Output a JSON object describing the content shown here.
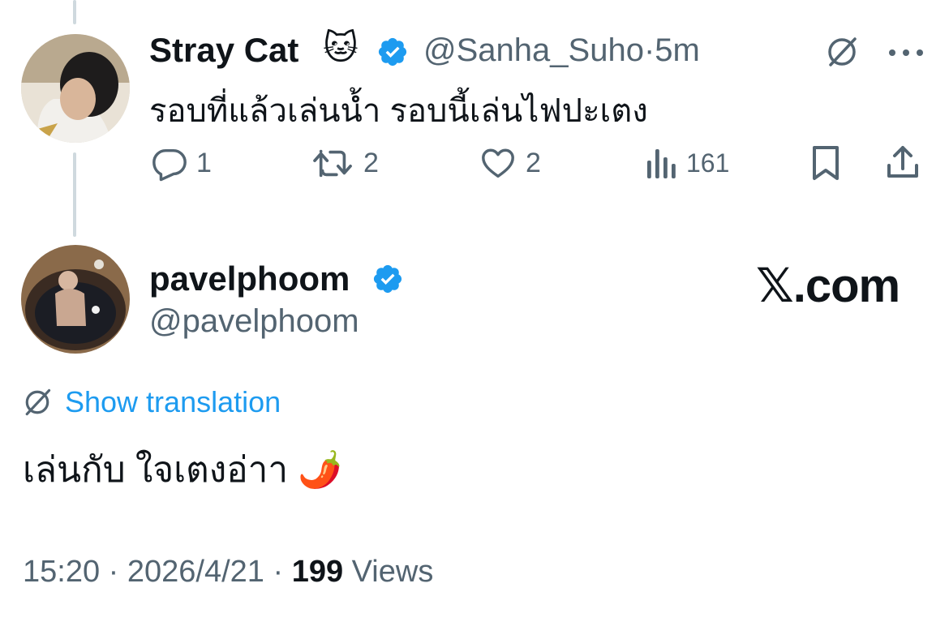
{
  "reply_tweet": {
    "display_name": "Stray Cat",
    "name_emoji": "🐱",
    "handle": "@Sanha_Suho",
    "separator": "·",
    "time_ago": "5m",
    "text": "รอบที่แล้วเล่นน้ำ รอบนี้เล่นไฟปะเตง",
    "actions": {
      "replies": "1",
      "retweets": "2",
      "likes": "2",
      "views": "161"
    }
  },
  "main_tweet": {
    "display_name": "pavelphoom",
    "handle": "@pavelphoom",
    "source_logo": "𝕏.com",
    "translate_label": "Show translation",
    "text": "เล่นกับ ใจเตงอ่าา 🌶️",
    "timestamp": "15:20 · 2026/4/21 · ",
    "views_count": "199",
    "views_label": " Views"
  },
  "colors": {
    "accent": "#1d9bf0",
    "muted": "#536471",
    "text": "#0f1419",
    "thread_line": "#cfd9de"
  },
  "icons": [
    "translate-icon",
    "more-icon",
    "reply-icon",
    "retweet-icon",
    "like-icon",
    "views-icon",
    "bookmark-icon",
    "share-icon",
    "verified-badge-icon"
  ]
}
